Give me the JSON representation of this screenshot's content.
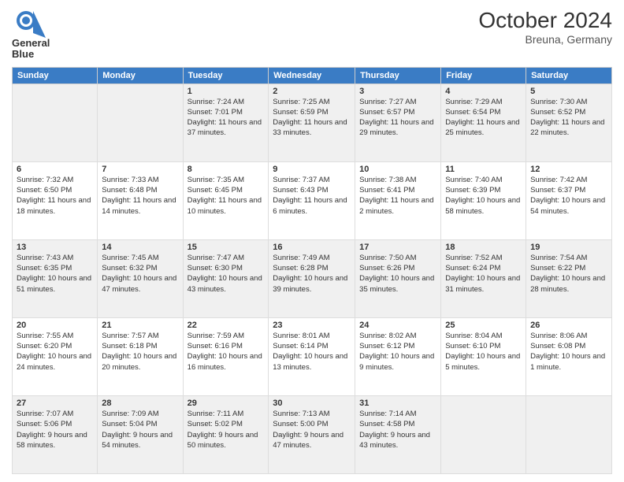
{
  "header": {
    "logo_line1": "General",
    "logo_line2": "Blue",
    "title": "October 2024",
    "subtitle": "Breuna, Germany"
  },
  "days_of_week": [
    "Sunday",
    "Monday",
    "Tuesday",
    "Wednesday",
    "Thursday",
    "Friday",
    "Saturday"
  ],
  "weeks": [
    {
      "days": [
        {
          "num": "",
          "info": ""
        },
        {
          "num": "",
          "info": ""
        },
        {
          "num": "1",
          "info": "Sunrise: 7:24 AM\nSunset: 7:01 PM\nDaylight: 11 hours and 37 minutes."
        },
        {
          "num": "2",
          "info": "Sunrise: 7:25 AM\nSunset: 6:59 PM\nDaylight: 11 hours and 33 minutes."
        },
        {
          "num": "3",
          "info": "Sunrise: 7:27 AM\nSunset: 6:57 PM\nDaylight: 11 hours and 29 minutes."
        },
        {
          "num": "4",
          "info": "Sunrise: 7:29 AM\nSunset: 6:54 PM\nDaylight: 11 hours and 25 minutes."
        },
        {
          "num": "5",
          "info": "Sunrise: 7:30 AM\nSunset: 6:52 PM\nDaylight: 11 hours and 22 minutes."
        }
      ]
    },
    {
      "days": [
        {
          "num": "6",
          "info": "Sunrise: 7:32 AM\nSunset: 6:50 PM\nDaylight: 11 hours and 18 minutes."
        },
        {
          "num": "7",
          "info": "Sunrise: 7:33 AM\nSunset: 6:48 PM\nDaylight: 11 hours and 14 minutes."
        },
        {
          "num": "8",
          "info": "Sunrise: 7:35 AM\nSunset: 6:45 PM\nDaylight: 11 hours and 10 minutes."
        },
        {
          "num": "9",
          "info": "Sunrise: 7:37 AM\nSunset: 6:43 PM\nDaylight: 11 hours and 6 minutes."
        },
        {
          "num": "10",
          "info": "Sunrise: 7:38 AM\nSunset: 6:41 PM\nDaylight: 11 hours and 2 minutes."
        },
        {
          "num": "11",
          "info": "Sunrise: 7:40 AM\nSunset: 6:39 PM\nDaylight: 10 hours and 58 minutes."
        },
        {
          "num": "12",
          "info": "Sunrise: 7:42 AM\nSunset: 6:37 PM\nDaylight: 10 hours and 54 minutes."
        }
      ]
    },
    {
      "days": [
        {
          "num": "13",
          "info": "Sunrise: 7:43 AM\nSunset: 6:35 PM\nDaylight: 10 hours and 51 minutes."
        },
        {
          "num": "14",
          "info": "Sunrise: 7:45 AM\nSunset: 6:32 PM\nDaylight: 10 hours and 47 minutes."
        },
        {
          "num": "15",
          "info": "Sunrise: 7:47 AM\nSunset: 6:30 PM\nDaylight: 10 hours and 43 minutes."
        },
        {
          "num": "16",
          "info": "Sunrise: 7:49 AM\nSunset: 6:28 PM\nDaylight: 10 hours and 39 minutes."
        },
        {
          "num": "17",
          "info": "Sunrise: 7:50 AM\nSunset: 6:26 PM\nDaylight: 10 hours and 35 minutes."
        },
        {
          "num": "18",
          "info": "Sunrise: 7:52 AM\nSunset: 6:24 PM\nDaylight: 10 hours and 31 minutes."
        },
        {
          "num": "19",
          "info": "Sunrise: 7:54 AM\nSunset: 6:22 PM\nDaylight: 10 hours and 28 minutes."
        }
      ]
    },
    {
      "days": [
        {
          "num": "20",
          "info": "Sunrise: 7:55 AM\nSunset: 6:20 PM\nDaylight: 10 hours and 24 minutes."
        },
        {
          "num": "21",
          "info": "Sunrise: 7:57 AM\nSunset: 6:18 PM\nDaylight: 10 hours and 20 minutes."
        },
        {
          "num": "22",
          "info": "Sunrise: 7:59 AM\nSunset: 6:16 PM\nDaylight: 10 hours and 16 minutes."
        },
        {
          "num": "23",
          "info": "Sunrise: 8:01 AM\nSunset: 6:14 PM\nDaylight: 10 hours and 13 minutes."
        },
        {
          "num": "24",
          "info": "Sunrise: 8:02 AM\nSunset: 6:12 PM\nDaylight: 10 hours and 9 minutes."
        },
        {
          "num": "25",
          "info": "Sunrise: 8:04 AM\nSunset: 6:10 PM\nDaylight: 10 hours and 5 minutes."
        },
        {
          "num": "26",
          "info": "Sunrise: 8:06 AM\nSunset: 6:08 PM\nDaylight: 10 hours and 1 minute."
        }
      ]
    },
    {
      "days": [
        {
          "num": "27",
          "info": "Sunrise: 7:07 AM\nSunset: 5:06 PM\nDaylight: 9 hours and 58 minutes."
        },
        {
          "num": "28",
          "info": "Sunrise: 7:09 AM\nSunset: 5:04 PM\nDaylight: 9 hours and 54 minutes."
        },
        {
          "num": "29",
          "info": "Sunrise: 7:11 AM\nSunset: 5:02 PM\nDaylight: 9 hours and 50 minutes."
        },
        {
          "num": "30",
          "info": "Sunrise: 7:13 AM\nSunset: 5:00 PM\nDaylight: 9 hours and 47 minutes."
        },
        {
          "num": "31",
          "info": "Sunrise: 7:14 AM\nSunset: 4:58 PM\nDaylight: 9 hours and 43 minutes."
        },
        {
          "num": "",
          "info": ""
        },
        {
          "num": "",
          "info": ""
        }
      ]
    }
  ]
}
